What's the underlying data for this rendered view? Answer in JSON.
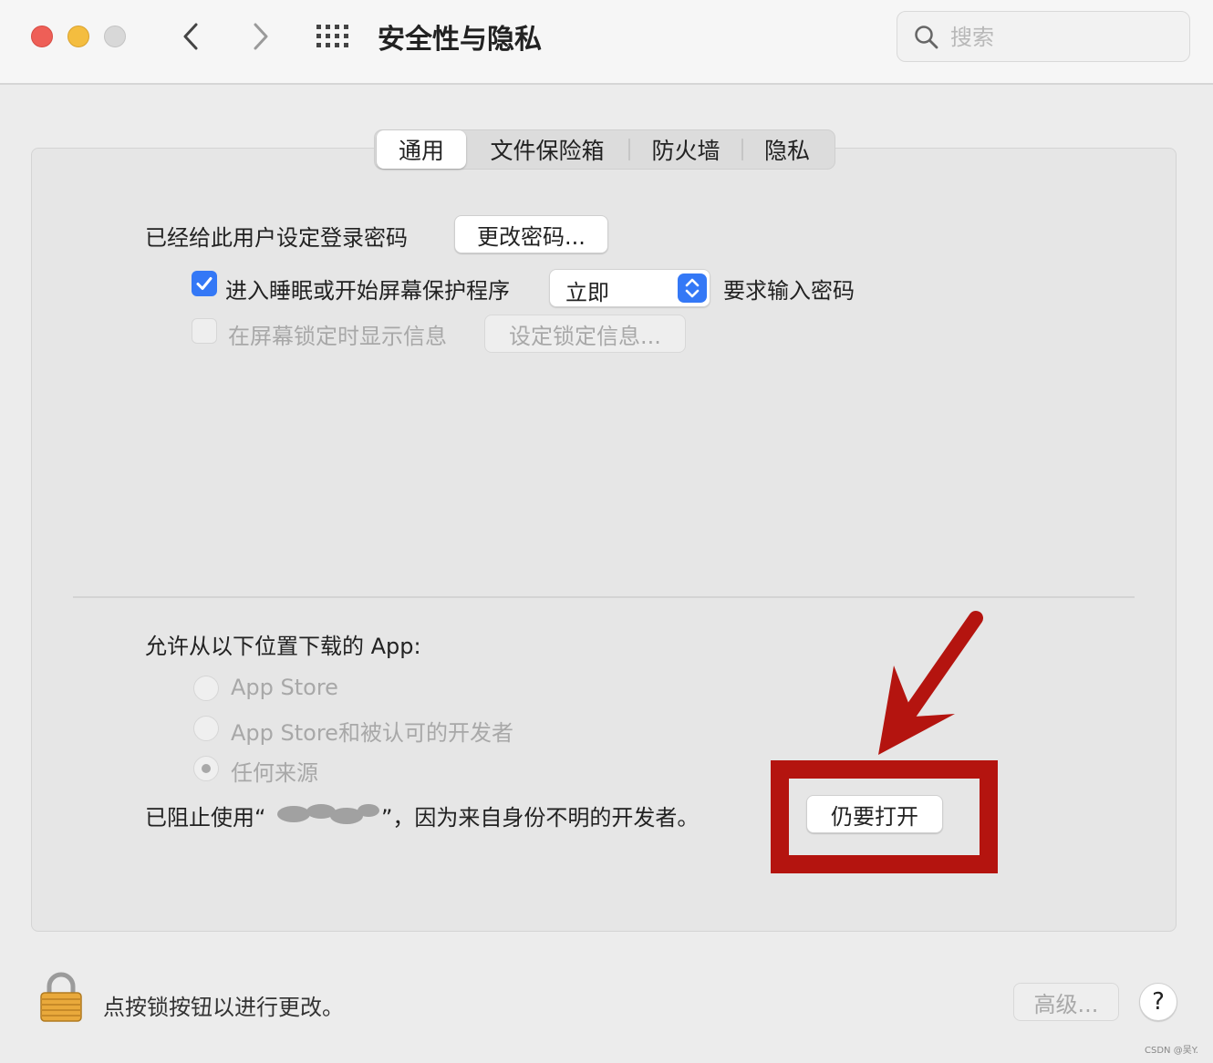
{
  "window": {
    "title": "安全性与隐私",
    "colors": {
      "close": "#ee5f57",
      "minimize": "#f4bd3f",
      "maximize": "#d8d8d8",
      "accent": "#3478f6",
      "highlight": "#b4140f"
    }
  },
  "search": {
    "placeholder": "搜索",
    "value": ""
  },
  "tabs": [
    {
      "label": "通用",
      "active": true
    },
    {
      "label": "文件保险箱",
      "active": false
    },
    {
      "label": "防火墙",
      "active": false
    },
    {
      "label": "隐私",
      "active": false
    }
  ],
  "general": {
    "password_set_label": "已经给此用户设定登录密码",
    "change_password_button": "更改密码...",
    "require_password": {
      "checked": true,
      "label_before": "进入睡眠或开始屏幕保护程序",
      "select_value": "立即",
      "label_after": "要求输入密码"
    },
    "show_message": {
      "checked": false,
      "label": "在屏幕锁定时显示信息",
      "button": "设定锁定信息..."
    }
  },
  "downloads": {
    "heading": "允许从以下位置下载的 App:",
    "options": [
      {
        "label": "App Store",
        "selected": false
      },
      {
        "label": "App Store和被认可的开发者",
        "selected": false
      },
      {
        "label": "任何来源",
        "selected": true
      }
    ],
    "blocked_prefix": "已阻止使用“",
    "blocked_suffix": "”，因为来自身份不明的开发者。",
    "open_anyway_button": "仍要打开"
  },
  "footer": {
    "lock_label": "点按锁按钮以进行更改。",
    "advanced_button": "高级...",
    "help_button": "?"
  },
  "watermark": "CSDN @吴Y."
}
